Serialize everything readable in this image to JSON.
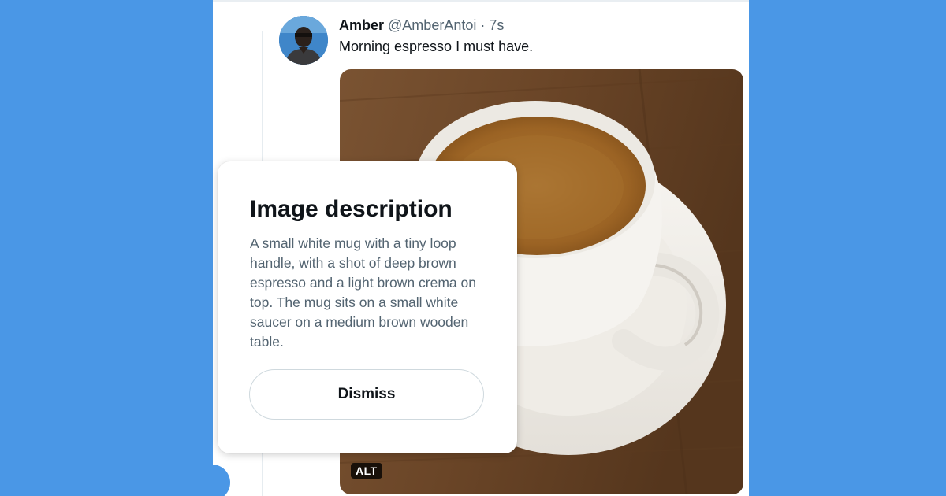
{
  "tweet": {
    "author_name": "Amber",
    "handle": "@AmberAntoi",
    "separator": "·",
    "time": "7s",
    "text": "Morning espresso I must have."
  },
  "media": {
    "alt_badge": "ALT"
  },
  "image_description": {
    "title": "Image description",
    "text": "A small white mug with a tiny loop handle, with a shot of deep brown espresso and a light brown crema on top. The mug sits on a small white saucer on a medium brown wooden table.",
    "dismiss_label": "Dismiss"
  },
  "colors": {
    "background": "#4a97e6",
    "panel": "#ffffff",
    "text_primary": "#0f1419",
    "text_secondary": "#536471"
  }
}
